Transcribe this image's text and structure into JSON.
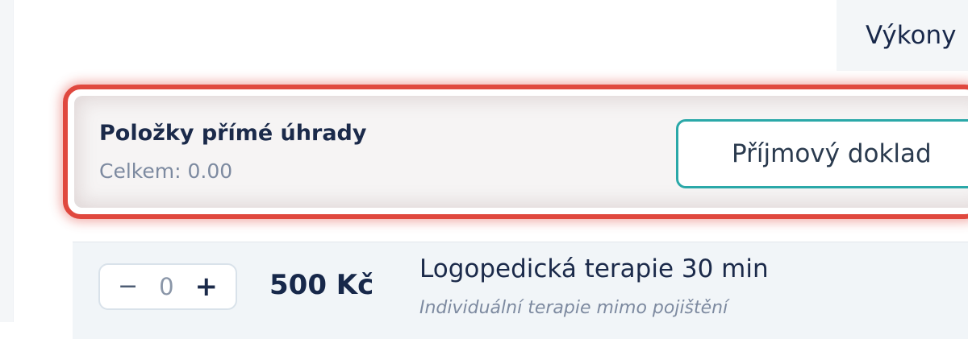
{
  "tabs": {
    "vykony_label": "Výkony"
  },
  "direct_payment": {
    "title": "Položky přímé úhrady",
    "total_label": "Celkem: 0.00",
    "receipt_button_label": "Příjmový doklad",
    "highlight_color": "#e0483e",
    "button_border_color": "#2aa8a8"
  },
  "items": [
    {
      "quantity": "0",
      "minus_symbol": "−",
      "plus_symbol": "+",
      "price": "500 Kč",
      "name": "Logopedická terapie 30 min",
      "description": "Individuální terapie mimo pojištění"
    }
  ]
}
